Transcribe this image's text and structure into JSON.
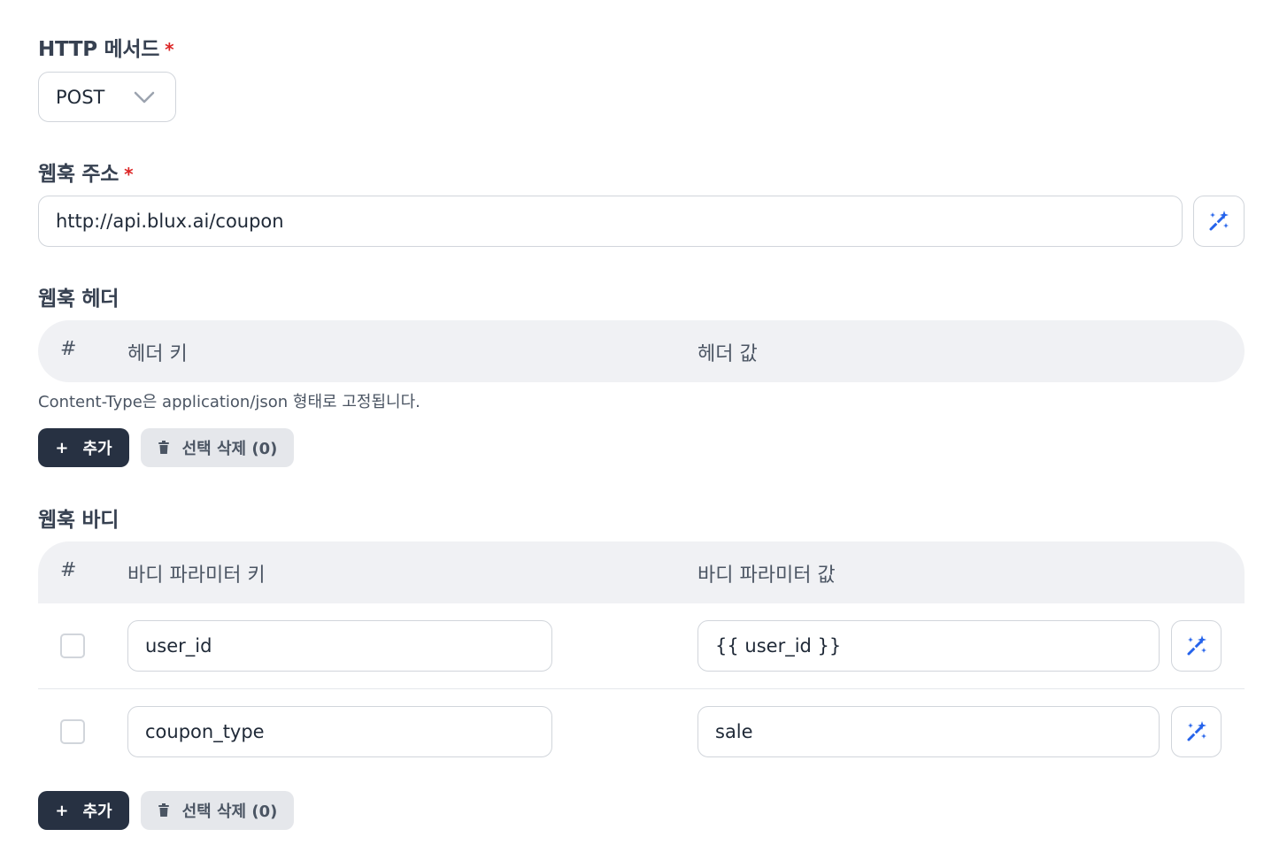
{
  "method": {
    "label": "HTTP 메서드",
    "required_mark": "*",
    "value": "POST"
  },
  "url": {
    "label": "웹훅 주소",
    "required_mark": "*",
    "value": "http://api.blux.ai/coupon"
  },
  "headers": {
    "label": "웹훅 헤더",
    "columns": {
      "index": "#",
      "key": "헤더 키",
      "value": "헤더 값"
    },
    "note": "Content-Type은 application/json 형태로 고정됩니다.",
    "add_label": "추가",
    "delete_label": "선택 삭제 (0)"
  },
  "body": {
    "label": "웹훅 바디",
    "columns": {
      "index": "#",
      "key": "바디 파라미터 키",
      "value": "바디 파라미터 값"
    },
    "rows": [
      {
        "key": "user_id",
        "value": "{{ user_id }}",
        "checked": false
      },
      {
        "key": "coupon_type",
        "value": "sale",
        "checked": false
      }
    ],
    "add_label": "추가",
    "delete_label": "선택 삭제 (0)"
  },
  "icons": {
    "magic": "magic-wand-icon",
    "chevron": "chevron-down-icon",
    "trash": "trash-icon",
    "plus": "plus-icon"
  },
  "colors": {
    "primary_button": "#273142",
    "accent_icon": "#2563eb",
    "required": "#dc2626",
    "table_header_bg": "#f0f1f4"
  }
}
